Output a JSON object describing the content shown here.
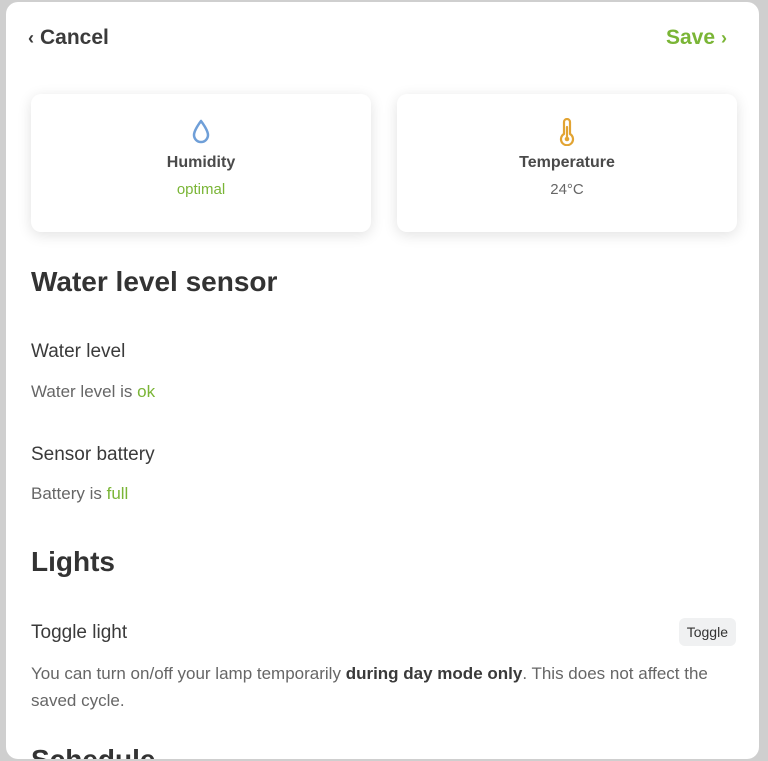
{
  "header": {
    "cancel_label": "Cancel",
    "save_label": "Save"
  },
  "cards": {
    "humidity": {
      "title": "Humidity",
      "value": "optimal",
      "icon": "water-drop-icon"
    },
    "temperature": {
      "title": "Temperature",
      "value": "24°C",
      "icon": "thermometer-icon"
    }
  },
  "water_sensor": {
    "title": "Water level sensor",
    "water_level_label": "Water level",
    "water_level_prefix": "Water level is",
    "water_level_value": "ok",
    "battery_label": "Sensor battery",
    "battery_prefix": "Battery is",
    "battery_value": "full"
  },
  "lights": {
    "title": "Lights",
    "toggle_label": "Toggle light",
    "toggle_button": "Toggle",
    "desc_part1": "You can turn on/off your lamp temporarily ",
    "desc_bold": "during day mode only",
    "desc_part2": ". This does not affect the saved cycle."
  },
  "next_section": {
    "title": "Schedule"
  },
  "colors": {
    "accent_green": "#7ab536",
    "drop_blue": "#6f9fd8",
    "thermo_orange": "#e2a433"
  }
}
